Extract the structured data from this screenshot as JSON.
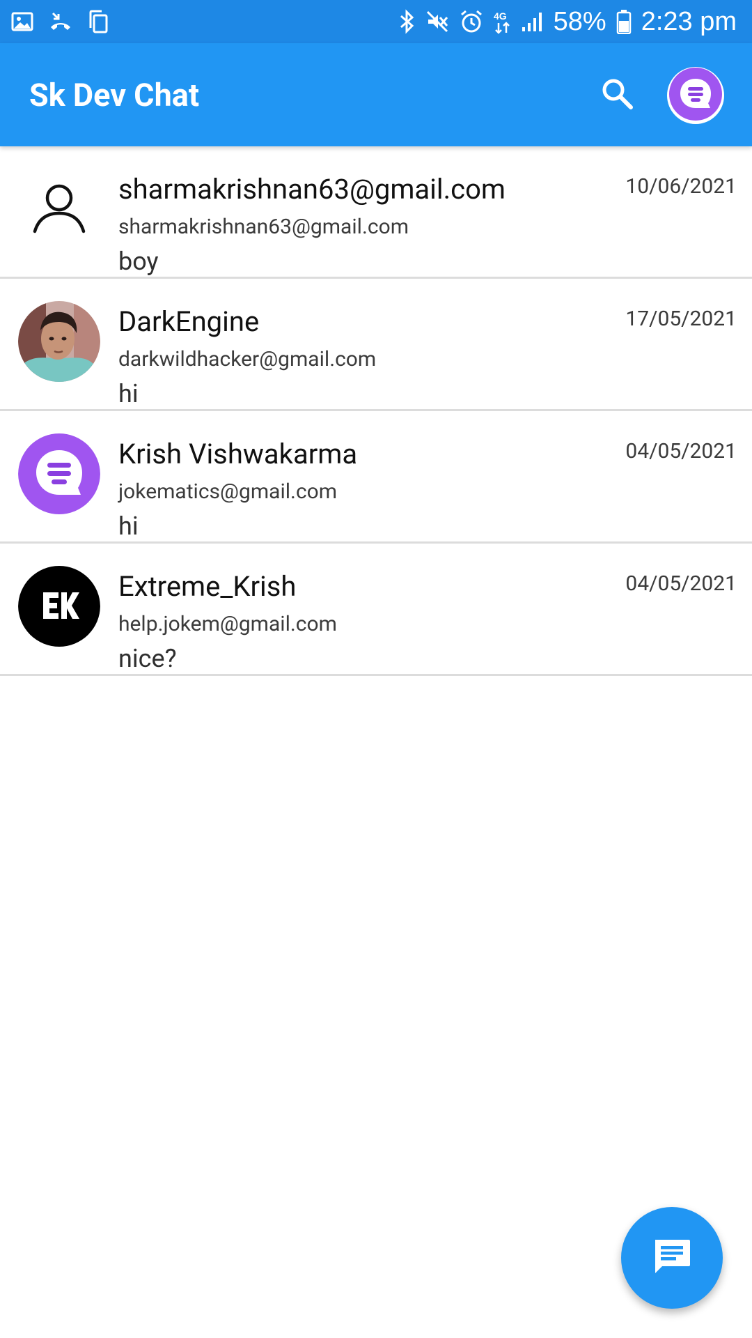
{
  "status_bar": {
    "icons_left": [
      "image-icon",
      "missed-call-icon",
      "copy-icon"
    ],
    "icons_right": [
      "bluetooth-icon",
      "mute-icon",
      "alarm-icon",
      "network-4g-icon",
      "signal-icon",
      "battery-icon"
    ],
    "battery": "58%",
    "time": "2:23 pm",
    "color": "#1e88e5"
  },
  "app_bar": {
    "title": "Sk Dev Chat",
    "color": "#2196f3",
    "search_icon": "search-icon",
    "profile_icon": "chat-bubble-icon"
  },
  "chats": [
    {
      "name": "sharmakrishnan63@gmail.com",
      "email": "sharmakrishnan63@gmail.com",
      "message": "boy",
      "date": "10/06/2021",
      "avatar": "default-user-icon"
    },
    {
      "name": "DarkEngine",
      "email": "darkwildhacker@gmail.com",
      "message": "hi",
      "date": "17/05/2021",
      "avatar": "photo"
    },
    {
      "name": "Krish Vishwakarma",
      "email": "jokematics@gmail.com",
      "message": "hi",
      "date": "04/05/2021",
      "avatar": "chat-bubble-icon"
    },
    {
      "name": "Extreme_Krish",
      "email": "help.jokem@gmail.com",
      "message": "nice?",
      "date": "04/05/2021",
      "avatar": "ek-logo"
    }
  ],
  "fab": {
    "icon": "message-icon",
    "color": "#2196f3"
  }
}
